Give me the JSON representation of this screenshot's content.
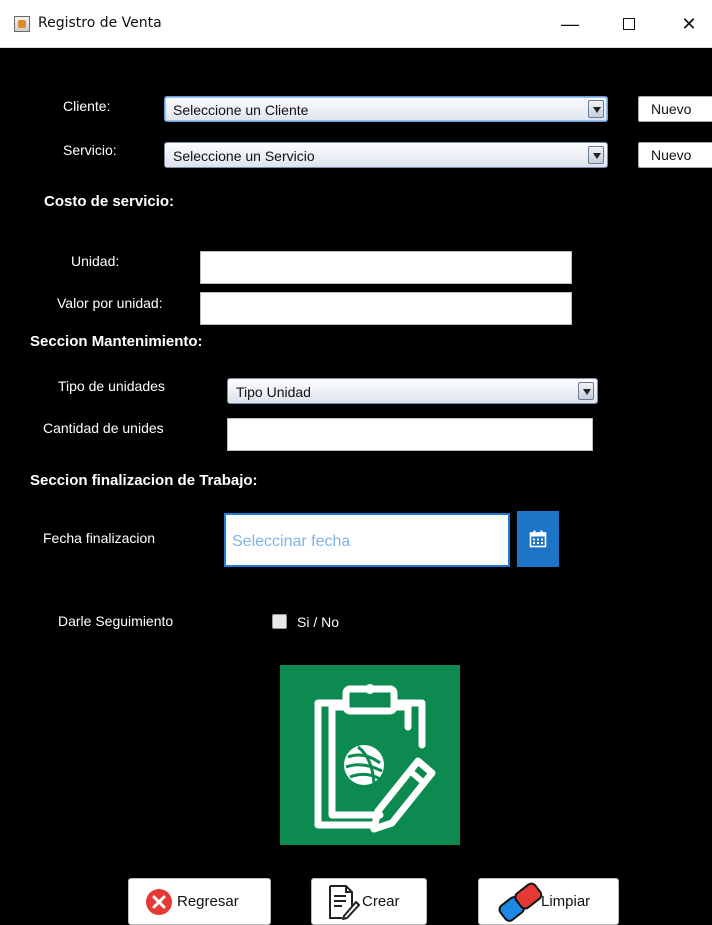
{
  "window": {
    "title": "Registro de Venta",
    "minimize_glyph": "—",
    "close_glyph": "✕"
  },
  "cliente": {
    "label": "Cliente:",
    "selected": "Seleccione un Cliente",
    "nuevo": "Nuevo"
  },
  "servicio": {
    "label": "Servicio:",
    "selected": "Seleccione un Servicio",
    "nuevo": "Nuevo"
  },
  "costo": {
    "header": "Costo de servicio:",
    "unidad_label": "Unidad:",
    "valor_label": "Valor por unidad:"
  },
  "mantenimiento": {
    "header": "Seccion Mantenimiento:",
    "tipo_label": "Tipo de unidades",
    "tipo_selected": "Tipo Unidad",
    "cantidad_label": "Cantidad de unides"
  },
  "finalizacion": {
    "header": "Seccion finalizacion de Trabajo:",
    "fecha_label": "Fecha finalizacion",
    "fecha_placeholder": "Seleccinar fecha"
  },
  "seguimiento": {
    "label": "Darle Seguimiento",
    "checkbox_label": "Si / No",
    "checked": false
  },
  "buttons": {
    "regresar": "Regresar",
    "crear": "Crear",
    "limpiar": "Limpiar"
  },
  "colors": {
    "accent_blue": "#1b74c5",
    "logo_green": "#0c8a4f",
    "cancel_red": "#e53935",
    "background": "#000000"
  },
  "icons": {
    "app": "java-app-icon",
    "calendar": "calendar-icon",
    "logo": "clipboard-yarn-pencil-icon",
    "regresar": "close-circle-icon",
    "crear": "document-edit-icon",
    "limpiar": "eraser-icon"
  }
}
